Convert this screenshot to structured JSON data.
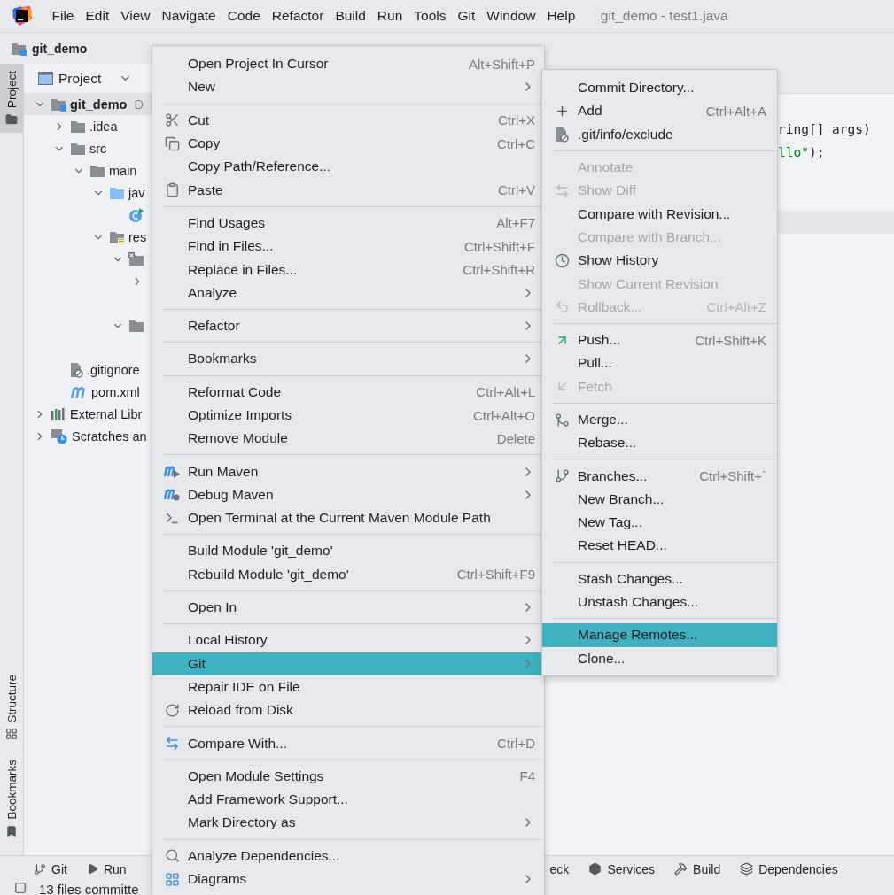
{
  "menubar": {
    "items": [
      "File",
      "Edit",
      "View",
      "Navigate",
      "Code",
      "Refactor",
      "Build",
      "Run",
      "Tools",
      "Git",
      "Window",
      "Help"
    ],
    "title": "git_demo - test1.java"
  },
  "navbar": {
    "project": "git_demo"
  },
  "left_stripe": {
    "top": [
      {
        "label": "Project",
        "selected": true
      }
    ],
    "bottom": [
      {
        "label": "Structure",
        "selected": false
      },
      {
        "label": "Bookmarks",
        "selected": false
      }
    ]
  },
  "project_panel": {
    "title": "Project",
    "tree": [
      {
        "label": "git_demo",
        "suffix": "D",
        "kind": "module",
        "expanded": true,
        "children": [
          {
            "label": ".idea",
            "kind": "folder",
            "expanded": false
          },
          {
            "label": "src",
            "kind": "folder",
            "expanded": true,
            "children": [
              {
                "label": "main",
                "kind": "folder",
                "expanded": true,
                "children": [
                  {
                    "label": "jav",
                    "kind": "source-folder",
                    "expanded": true,
                    "children": [
                      {
                        "kind": "class"
                      }
                    ]
                  },
                  {
                    "label": "res",
                    "kind": "resource-folder",
                    "expanded": true,
                    "children": [
                      {
                        "kind": "excluded-folder",
                        "expanded": true,
                        "children": [
                          {
                            "expanded": false
                          }
                        ]
                      },
                      {
                        "kind": "folder",
                        "expanded": true
                      }
                    ]
                  }
                ]
              }
            ]
          },
          {
            "label": ".gitignore",
            "kind": "ignored-file"
          },
          {
            "label": "pom.xml",
            "kind": "maven-file"
          }
        ]
      },
      {
        "label": "External Libr",
        "kind": "libraries",
        "expanded": false
      },
      {
        "label": "Scratches an",
        "kind": "scratches",
        "expanded": false
      }
    ]
  },
  "editor": {
    "lines": [
      {
        "current": false,
        "segments": [
          {
            "text": "ring[] args)",
            "kind": "plain"
          }
        ]
      },
      {
        "current": false,
        "segments": [
          {
            "text": "llo\"",
            "kind": "string"
          },
          {
            "text": ");",
            "kind": "plain"
          }
        ]
      },
      {
        "current": false
      },
      {
        "current": false
      },
      {
        "current": true
      }
    ]
  },
  "tool_strip": {
    "left": [
      "Git",
      "Run"
    ],
    "right": [
      "eck",
      "Services",
      "Build",
      "Dependencies"
    ]
  },
  "status_bar": {
    "text": "13 files committe"
  },
  "context_menu": {
    "items": [
      {
        "kind": "item",
        "label": "Open Project In Cursor",
        "shortcut": "Alt+Shift+P",
        "submenu": false,
        "selected": false,
        "disabled": false
      },
      {
        "kind": "item",
        "label": "New",
        "submenu": true,
        "selected": false,
        "disabled": false
      },
      {
        "kind": "separator"
      },
      {
        "kind": "item",
        "label": "Cut",
        "shortcut": "Ctrl+X",
        "submenu": false,
        "selected": false,
        "disabled": false
      },
      {
        "kind": "item",
        "label": "Copy",
        "shortcut": "Ctrl+C",
        "submenu": false,
        "selected": false,
        "disabled": false
      },
      {
        "kind": "item",
        "label": "Copy Path/Reference...",
        "submenu": false,
        "selected": false,
        "disabled": false
      },
      {
        "kind": "item",
        "label": "Paste",
        "shortcut": "Ctrl+V",
        "submenu": false,
        "selected": false,
        "disabled": false
      },
      {
        "kind": "separator"
      },
      {
        "kind": "item",
        "label": "Find Usages",
        "shortcut": "Alt+F7",
        "submenu": false,
        "selected": false,
        "disabled": false
      },
      {
        "kind": "item",
        "label": "Find in Files...",
        "shortcut": "Ctrl+Shift+F",
        "submenu": false,
        "selected": false,
        "disabled": false
      },
      {
        "kind": "item",
        "label": "Replace in Files...",
        "shortcut": "Ctrl+Shift+R",
        "submenu": false,
        "selected": false,
        "disabled": false
      },
      {
        "kind": "item",
        "label": "Analyze",
        "submenu": true,
        "selected": false,
        "disabled": false
      },
      {
        "kind": "separator"
      },
      {
        "kind": "item",
        "label": "Refactor",
        "submenu": true,
        "selected": false,
        "disabled": false
      },
      {
        "kind": "separator"
      },
      {
        "kind": "item",
        "label": "Bookmarks",
        "submenu": true,
        "selected": false,
        "disabled": false
      },
      {
        "kind": "separator"
      },
      {
        "kind": "item",
        "label": "Reformat Code",
        "shortcut": "Ctrl+Alt+L",
        "submenu": false,
        "selected": false,
        "disabled": false
      },
      {
        "kind": "item",
        "label": "Optimize Imports",
        "shortcut": "Ctrl+Alt+O",
        "submenu": false,
        "selected": false,
        "disabled": false
      },
      {
        "kind": "item",
        "label": "Remove Module",
        "shortcut": "Delete",
        "submenu": false,
        "selected": false,
        "disabled": false
      },
      {
        "kind": "separator"
      },
      {
        "kind": "item",
        "label": "Run Maven",
        "submenu": true,
        "selected": false,
        "disabled": false
      },
      {
        "kind": "item",
        "label": "Debug Maven",
        "submenu": true,
        "selected": false,
        "disabled": false
      },
      {
        "kind": "item",
        "label": "Open Terminal at the Current Maven Module Path",
        "submenu": false,
        "selected": false,
        "disabled": false
      },
      {
        "kind": "separator"
      },
      {
        "kind": "item",
        "label": "Build Module 'git_demo'",
        "submenu": false,
        "selected": false,
        "disabled": false
      },
      {
        "kind": "item",
        "label": "Rebuild Module 'git_demo'",
        "shortcut": "Ctrl+Shift+F9",
        "submenu": false,
        "selected": false,
        "disabled": false
      },
      {
        "kind": "separator"
      },
      {
        "kind": "item",
        "label": "Open In",
        "submenu": true,
        "selected": false,
        "disabled": false
      },
      {
        "kind": "separator"
      },
      {
        "kind": "item",
        "label": "Local History",
        "submenu": true,
        "selected": false,
        "disabled": false
      },
      {
        "kind": "item",
        "label": "Git",
        "submenu": true,
        "selected": true,
        "disabled": false
      },
      {
        "kind": "item",
        "label": "Repair IDE on File",
        "submenu": false,
        "selected": false,
        "disabled": false
      },
      {
        "kind": "item",
        "label": "Reload from Disk",
        "submenu": false,
        "selected": false,
        "disabled": false
      },
      {
        "kind": "separator"
      },
      {
        "kind": "item",
        "label": "Compare With...",
        "shortcut": "Ctrl+D",
        "submenu": false,
        "selected": false,
        "disabled": false
      },
      {
        "kind": "separator"
      },
      {
        "kind": "item",
        "label": "Open Module Settings",
        "shortcut": "F4",
        "submenu": false,
        "selected": false,
        "disabled": false
      },
      {
        "kind": "item",
        "label": "Add Framework Support...",
        "submenu": false,
        "selected": false,
        "disabled": false
      },
      {
        "kind": "item",
        "label": "Mark Directory as",
        "submenu": true,
        "selected": false,
        "disabled": false
      },
      {
        "kind": "separator"
      },
      {
        "kind": "item",
        "label": "Analyze Dependencies...",
        "submenu": false,
        "selected": false,
        "disabled": false
      },
      {
        "kind": "item",
        "label": "Diagrams",
        "submenu": true,
        "selected": false,
        "disabled": false
      }
    ]
  },
  "git_submenu": {
    "items": [
      {
        "kind": "item",
        "label": "Commit Directory...",
        "submenu": false,
        "selected": false,
        "disabled": false
      },
      {
        "kind": "item",
        "label": "Add",
        "shortcut": "Ctrl+Alt+A",
        "submenu": false,
        "selected": false,
        "disabled": false
      },
      {
        "kind": "item",
        "label": ".git/info/exclude",
        "submenu": false,
        "selected": false,
        "disabled": false
      },
      {
        "kind": "separator"
      },
      {
        "kind": "item",
        "label": "Annotate",
        "submenu": false,
        "selected": false,
        "disabled": true
      },
      {
        "kind": "item",
        "label": "Show Diff",
        "submenu": false,
        "selected": false,
        "disabled": true
      },
      {
        "kind": "item",
        "label": "Compare with Revision...",
        "submenu": false,
        "selected": false,
        "disabled": false
      },
      {
        "kind": "item",
        "label": "Compare with Branch...",
        "submenu": false,
        "selected": false,
        "disabled": true
      },
      {
        "kind": "item",
        "label": "Show History",
        "submenu": false,
        "selected": false,
        "disabled": false
      },
      {
        "kind": "item",
        "label": "Show Current Revision",
        "submenu": false,
        "selected": false,
        "disabled": true
      },
      {
        "kind": "item",
        "label": "Rollback...",
        "shortcut": "Ctrl+Alt+Z",
        "submenu": false,
        "selected": false,
        "disabled": true
      },
      {
        "kind": "separator"
      },
      {
        "kind": "item",
        "label": "Push...",
        "shortcut": "Ctrl+Shift+K",
        "submenu": false,
        "selected": false,
        "disabled": false
      },
      {
        "kind": "item",
        "label": "Pull...",
        "submenu": false,
        "selected": false,
        "disabled": false
      },
      {
        "kind": "item",
        "label": "Fetch",
        "submenu": false,
        "selected": false,
        "disabled": true
      },
      {
        "kind": "separator"
      },
      {
        "kind": "item",
        "label": "Merge...",
        "submenu": false,
        "selected": false,
        "disabled": false
      },
      {
        "kind": "item",
        "label": "Rebase...",
        "submenu": false,
        "selected": false,
        "disabled": false
      },
      {
        "kind": "separator"
      },
      {
        "kind": "item",
        "label": "Branches...",
        "shortcut": "Ctrl+Shift+`",
        "submenu": false,
        "selected": false,
        "disabled": false
      },
      {
        "kind": "item",
        "label": "New Branch...",
        "submenu": false,
        "selected": false,
        "disabled": false
      },
      {
        "kind": "item",
        "label": "New Tag...",
        "submenu": false,
        "selected": false,
        "disabled": false
      },
      {
        "kind": "item",
        "label": "Reset HEAD...",
        "submenu": false,
        "selected": false,
        "disabled": false
      },
      {
        "kind": "separator"
      },
      {
        "kind": "item",
        "label": "Stash Changes...",
        "submenu": false,
        "selected": false,
        "disabled": false
      },
      {
        "kind": "item",
        "label": "Unstash Changes...",
        "submenu": false,
        "selected": false,
        "disabled": false
      },
      {
        "kind": "separator"
      },
      {
        "kind": "item",
        "label": "Manage Remotes...",
        "submenu": false,
        "selected": true,
        "disabled": false
      },
      {
        "kind": "item",
        "label": "Clone...",
        "submenu": false,
        "selected": false,
        "disabled": false
      }
    ]
  }
}
